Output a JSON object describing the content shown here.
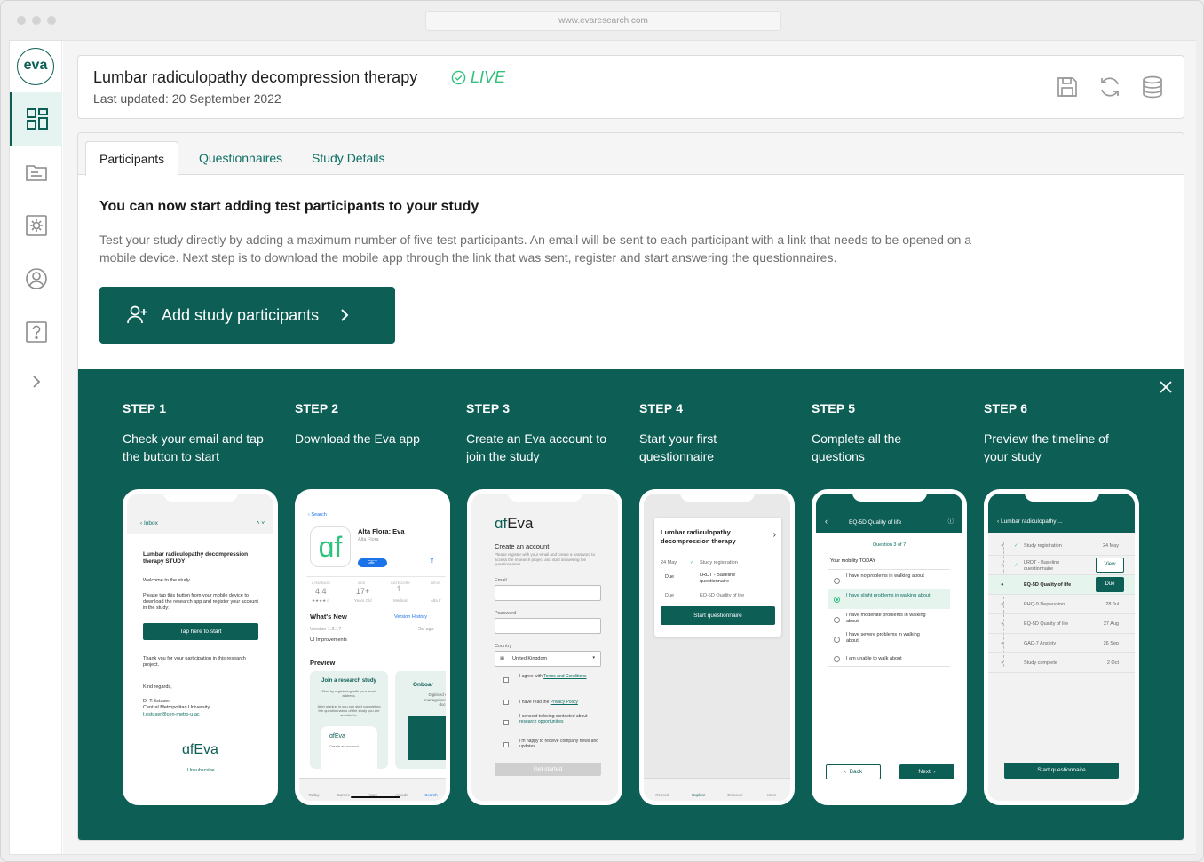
{
  "browser": {
    "url": "www.evaresearch.com"
  },
  "sidebar": {
    "logo": "eva",
    "items": [
      {
        "name": "dashboard"
      },
      {
        "name": "folder"
      },
      {
        "name": "settings"
      },
      {
        "name": "profile"
      },
      {
        "name": "help"
      },
      {
        "name": "expand"
      }
    ]
  },
  "header": {
    "title": "Lumbar radiculopathy decompression therapy",
    "status": "LIVE",
    "last_updated": "Last updated: 20 September 2022",
    "actions": [
      "save-icon",
      "refresh-icon",
      "database-icon"
    ]
  },
  "tabs": [
    {
      "label": "Participants",
      "active": true
    },
    {
      "label": "Questionnaires",
      "active": false
    },
    {
      "label": "Study Details",
      "active": false
    }
  ],
  "intro": {
    "heading": "You can now start adding test participants to your study",
    "text": "Test your study directly by adding a maximum number of five test participants. An email will be sent to each participant with a link that needs to be opened on a mobile device.  Next step is to download the mobile app through the link that was sent, register and start answering the questionnaires.",
    "button_label": "Add study participants"
  },
  "steps": [
    {
      "label": "STEP 1",
      "desc": "Check your email and tap the button to start"
    },
    {
      "label": "STEP 2",
      "desc": "Download the Eva app"
    },
    {
      "label": "STEP 3",
      "desc": "Create an Eva account to join the study"
    },
    {
      "label": "STEP 4",
      "desc": "Start your first questionnaire"
    },
    {
      "label": "STEP 5",
      "desc": "Complete all the questions"
    },
    {
      "label": "STEP 6",
      "desc": "Preview the timeline of your study"
    }
  ],
  "phone1": {
    "back": "Inbox",
    "subject": "Lumbar radiculopathy decompression therapy STUDY",
    "p1": "Welcome to the study.",
    "p2": "Please tap this button from your mobile device to download the research app and register your account in the study:",
    "button": "Tap here to start",
    "p3": "Thank you for your participation in this research project.",
    "p4": "Kind regards,",
    "sig1": "Dr T.Estuser",
    "sig2": "Central Metropolitan University",
    "sig3": "t.estuser@cen-metro-u.ac",
    "logo": "Eva",
    "unsubscribe": "Unsubscribe"
  },
  "phone2": {
    "back": "Search",
    "app_name": "Alta Flora: Eva",
    "developer": "Alta Flora",
    "get": "GET",
    "ratings_label": "8 RATINGS",
    "rating": "4.4",
    "stars": "★★★★☆",
    "age_label": "AGE",
    "age": "17+",
    "age_sub": "Years Old",
    "category_label": "CATEGORY",
    "category": "Medical",
    "dev_label": "DEVE",
    "dev_sub": "Alta F",
    "whats_new": "What's New",
    "version_history": "Version History",
    "version": "Version 1.3.17",
    "ago": "2w ago",
    "improvements": "UI Improvements",
    "preview": "Preview",
    "card1_title": "Join a research study",
    "card1_text": "Start by registering with your email address.",
    "card1_text2": "After signing in you can start completing the questionnaires of the study you are enrolled in.",
    "card1_logo": "Eva",
    "card1_sub": "Create an account",
    "card2_title": "Onboar",
    "card2_text": "Digitised conse management and documen",
    "tabs": [
      "Today",
      "Games",
      "Apps",
      "Arcade",
      "Search"
    ]
  },
  "phone3": {
    "logo": "Eva",
    "title": "Create an account",
    "text": "Please register with your email and create a password to access the research project and start answering the questionnaires.",
    "email": "Email",
    "password": "Password",
    "country": "Country",
    "country_value": "United Kingdom",
    "agree_prefix": "I agree with ",
    "agree_link": "Terms and Conditions",
    "privacy_prefix": "I have read the ",
    "privacy_link": "Privacy Policy",
    "consent_prefix": "I consent to being contacted about ",
    "consent_link": "research opportunities",
    "news": "I'm happy to receive company news and updates",
    "button": "Get started"
  },
  "phone4": {
    "title": "Lumbar radiculopathy decompression therapy",
    "date": "24 May",
    "done": "Study registration",
    "due": "Due",
    "item1": "LRDT - Baseline questionnaire",
    "due2": "Due",
    "item2": "EQ-5D Quality of life",
    "button": "Start questionnaire",
    "tabs": [
      "Record",
      "Explore",
      "Discover",
      "More"
    ]
  },
  "phone5": {
    "title": "EQ-5D Quality of life",
    "question": "Question 3 of 7",
    "prompt": "Your mobility TODAY",
    "options": [
      {
        "text": "I have no problems in walking about",
        "selected": false
      },
      {
        "text": "I have slight problems in walking about",
        "selected": true
      },
      {
        "text": "I have moderate problems in walking about",
        "selected": false
      },
      {
        "text": "I have severe problems in walking about",
        "selected": false
      },
      {
        "text": "I am unable to walk about",
        "selected": false
      }
    ],
    "back": "Back",
    "next": "Next"
  },
  "phone6": {
    "title": "Lumbar radiculopathy ...",
    "rows": [
      {
        "text": "Study registration",
        "date": "24 May"
      },
      {
        "text": "LRDT - Baseline questionnaire",
        "date": "",
        "action": "View"
      },
      {
        "text": "EQ-5D Quality of life",
        "date": "",
        "action": "Due"
      },
      {
        "text": "PHQ-9 Depression",
        "date": "28 Jul"
      },
      {
        "text": "EQ-5D Quality of life",
        "date": "27 Aug"
      },
      {
        "text": "GAD-7 Anxiety",
        "date": "26 Sep"
      },
      {
        "text": "Study complete",
        "date": "2 Oct"
      }
    ],
    "button": "Start  questionnaire"
  },
  "colors": {
    "brand": "#0d5e55",
    "live": "#32c07c",
    "tab_link": "#0d6e63"
  }
}
